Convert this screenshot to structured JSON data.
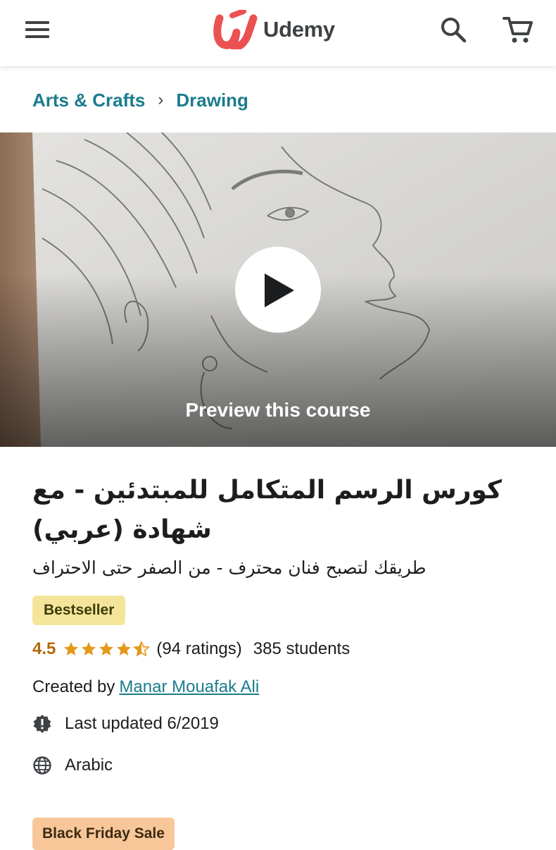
{
  "brand": {
    "name": "Udemy",
    "accent": "#ea5252"
  },
  "header": {
    "menu_icon": "hamburger-menu-icon",
    "search_icon": "search-icon",
    "cart_icon": "shopping-cart-icon"
  },
  "breadcrumb": [
    {
      "label": "Arts & Crafts"
    },
    {
      "label": "Drawing"
    }
  ],
  "preview": {
    "label": "Preview this course",
    "icon": "play-icon"
  },
  "course": {
    "title": "كورس الرسم المتكامل للمبتدئين - مع شهادة (عربي)",
    "subtitle": "طريقك لتصبح فنان محترف - من الصفر حتى الاحتراف",
    "bestseller_badge": "Bestseller",
    "rating": "4.5",
    "rating_value": 4.5,
    "ratings_count": "(94 ratings)",
    "students": "385 students",
    "created_by_label": "Created by",
    "author": "Manar Mouafak Ali",
    "last_updated": "Last updated 6/2019",
    "language": "Arabic",
    "sale_badge": "Black Friday Sale"
  },
  "colors": {
    "link": "#1a7c8c",
    "rating": "#b4690e",
    "star": "#e59819",
    "bestseller_bg": "#f5e59a",
    "sale_bg": "#f7c79a"
  }
}
